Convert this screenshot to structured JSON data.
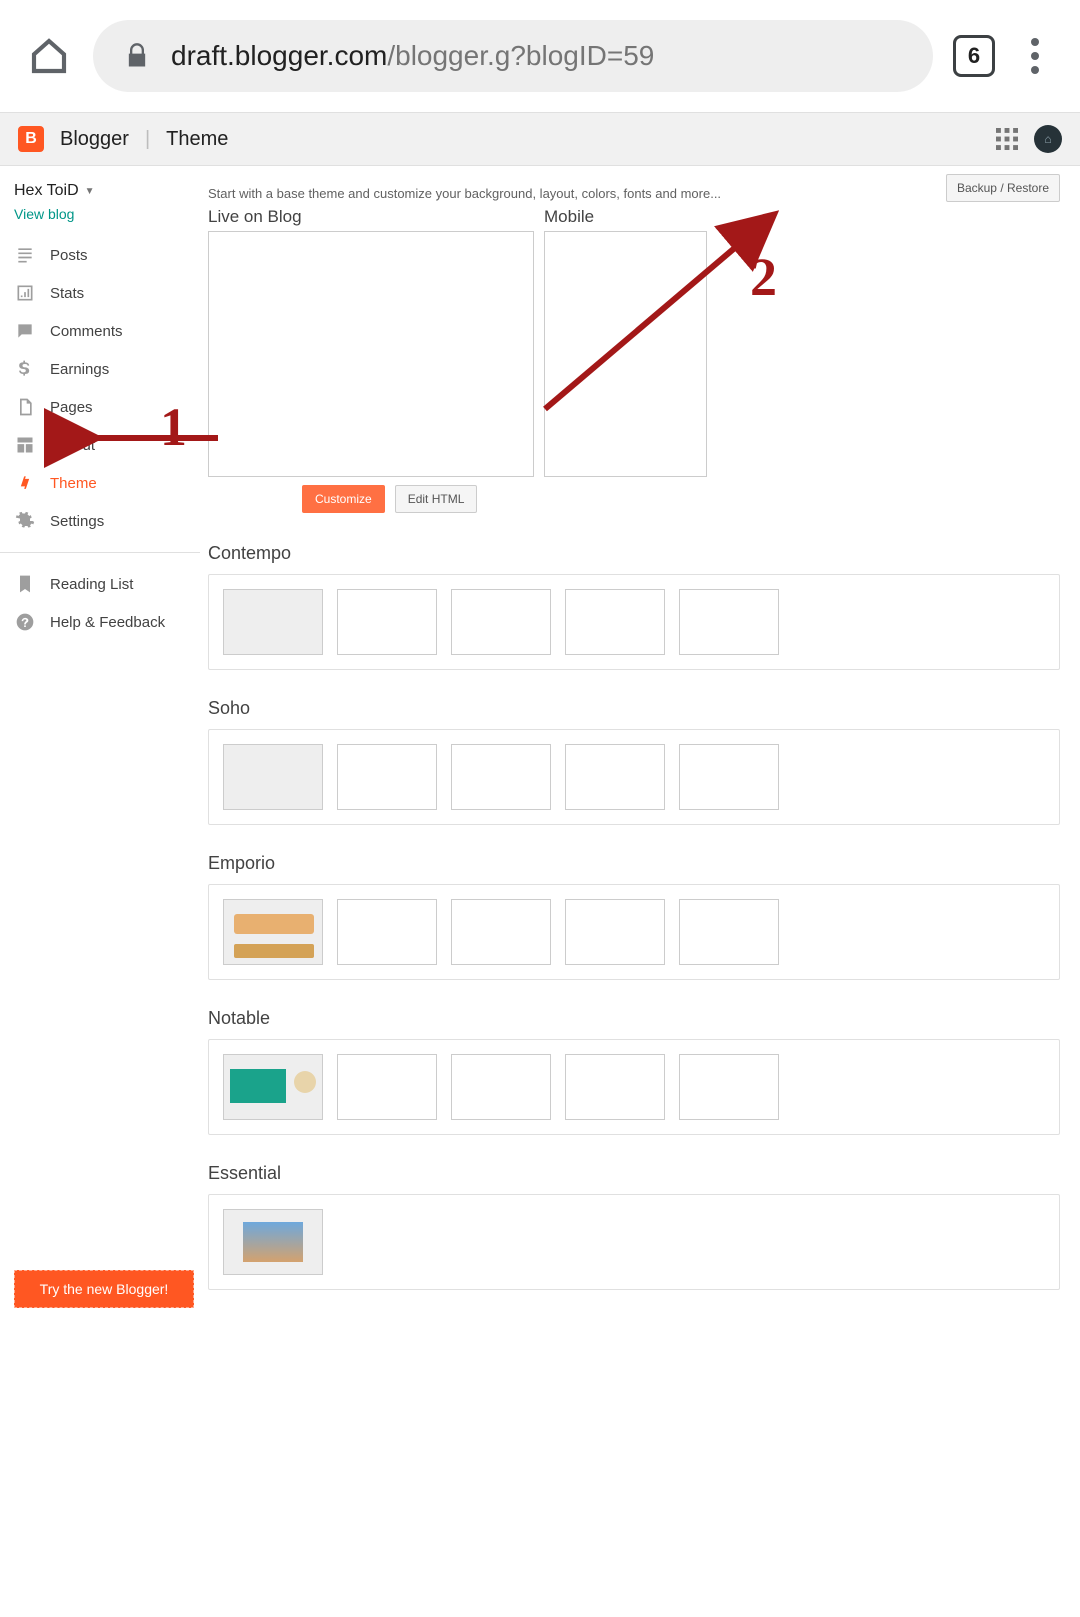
{
  "browser": {
    "url_host": "draft.blogger.com",
    "url_path": "/blogger.g?blogID=59",
    "tab_count": "6"
  },
  "header": {
    "product": "Blogger",
    "page": "Theme"
  },
  "sidebar": {
    "blog_name": "Hex ToiD",
    "view_blog": "View blog",
    "items": [
      {
        "label": "Posts"
      },
      {
        "label": "Stats"
      },
      {
        "label": "Comments"
      },
      {
        "label": "Earnings"
      },
      {
        "label": "Pages"
      },
      {
        "label": "Layout"
      },
      {
        "label": "Theme"
      },
      {
        "label": "Settings"
      }
    ],
    "secondary": [
      {
        "label": "Reading List"
      },
      {
        "label": "Help & Feedback"
      }
    ],
    "promo": "Try the new Blogger!"
  },
  "main": {
    "backup_restore": "Backup / Restore",
    "intro": "Start with a base theme and customize your background, layout, colors, fonts and more...",
    "live_label": "Live on Blog",
    "mobile_label": "Mobile",
    "customize": "Customize",
    "edit_html": "Edit HTML",
    "themes": [
      {
        "name": "Contempo"
      },
      {
        "name": "Soho"
      },
      {
        "name": "Emporio"
      },
      {
        "name": "Notable"
      },
      {
        "name": "Essential"
      }
    ]
  },
  "annotations": {
    "one": "1",
    "two": "2"
  }
}
